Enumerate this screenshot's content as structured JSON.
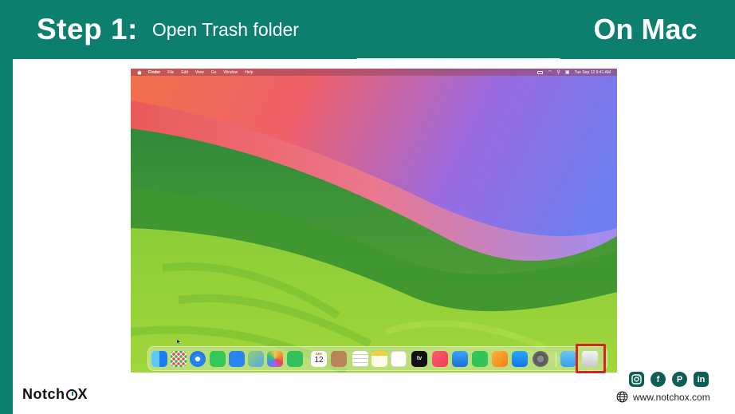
{
  "banner": {
    "step_number": "Step 1:",
    "step_text": "Open Trash folder",
    "platform": "On Mac"
  },
  "menubar": {
    "items": [
      "Finder",
      "File",
      "Edit",
      "View",
      "Go",
      "Window",
      "Help"
    ],
    "clock": "Tue Sep 12  9:41 AM"
  },
  "dock": {
    "calendar_month": "SEP",
    "calendar_day": "12",
    "tv_label": "tv",
    "apps": [
      "finder-icon",
      "launchpad-icon",
      "safari-icon",
      "messages-icon",
      "mail-icon",
      "maps-icon",
      "photos-icon",
      "facetime-icon",
      "calendar-icon",
      "contacts-icon",
      "reminders-icon",
      "notes-icon",
      "freeform-icon",
      "apple-tv-icon",
      "music-icon",
      "keynote-icon",
      "numbers-icon",
      "pages-icon",
      "app-store-icon",
      "system-settings-icon",
      "downloads-folder-icon",
      "trash-icon"
    ]
  },
  "brand": {
    "logo_left": "Notch",
    "logo_right": "X",
    "website": "www.notchox.com",
    "socials": [
      "instagram-icon",
      "facebook-icon",
      "pinterest-icon",
      "linkedin-icon"
    ]
  },
  "colors": {
    "brand_teal": "#0d7f6f",
    "highlight_red": "#d42424"
  }
}
